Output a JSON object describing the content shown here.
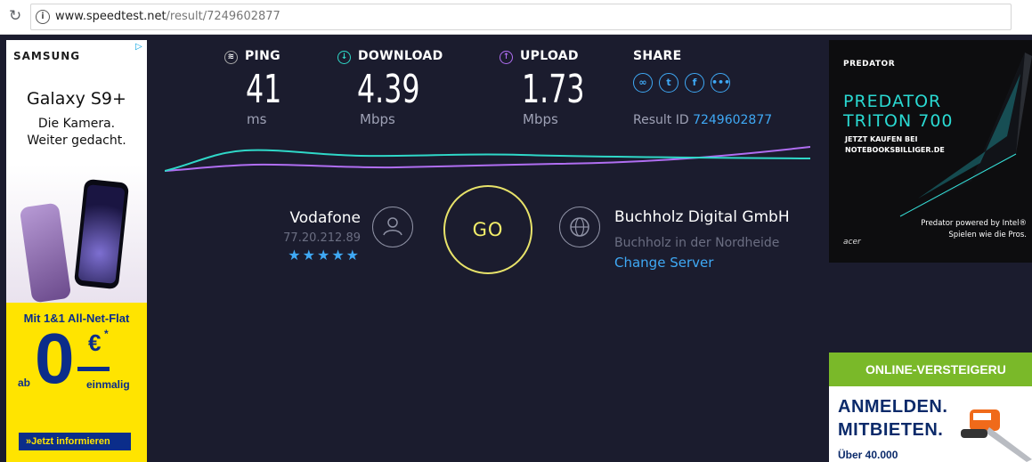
{
  "browser": {
    "url_domain": "www.speedtest.net",
    "url_path": "/result/7249602877"
  },
  "left_ad": {
    "brand": "SAMSUNG",
    "product": "Galaxy S9+",
    "tagline_1": "Die Kamera.",
    "tagline_2": "Weiter gedacht.",
    "offer": "Mit 1&1 All-Net-Flat",
    "price_prefix": "ab",
    "price_digit": "0",
    "price_currency": "€",
    "price_star": "*",
    "price_suffix": "einmalig",
    "cta": "»Jetzt informieren"
  },
  "results": {
    "ping": {
      "label": "PING",
      "value": "41",
      "unit": "ms"
    },
    "download": {
      "label": "DOWNLOAD",
      "value": "4.39",
      "unit": "Mbps"
    },
    "upload": {
      "label": "UPLOAD",
      "value": "1.73",
      "unit": "Mbps"
    },
    "share": {
      "label": "SHARE",
      "icons": [
        "link-icon",
        "twitter-icon",
        "facebook-icon",
        "more-icon"
      ]
    },
    "result_id_label": "Result ID",
    "result_id": "7249602877"
  },
  "isp": {
    "name": "Vodafone",
    "ip": "77.20.212.89",
    "stars": "★★★★★"
  },
  "go_label": "GO",
  "server": {
    "name": "Buchholz Digital GmbH",
    "location": "Buchholz in der Nordheide",
    "change_label": "Change Server"
  },
  "right_ad_1": {
    "brand": "PREDATOR",
    "title_1": "PREDATOR",
    "title_2": "TRITON 700",
    "cta_1": "JETZT KAUFEN BEI",
    "cta_2": "NOTEBOOKSBILLIGER.DE",
    "foot_1": "Predator powered by Intel®",
    "foot_2": "Spielen wie die Pros.",
    "maker": "acer"
  },
  "right_ad_2": {
    "header": "ONLINE-VERSTEIGERU",
    "line_1": "ANMELDEN.",
    "line_2": "MITBIETEN.",
    "small": "Über 40.000"
  },
  "colors": {
    "background": "#1b1c2e",
    "accent_blue": "#3fa9f5",
    "go_yellow": "#e8e36a",
    "download_line": "#2fd8c8",
    "upload_line": "#b06ef2"
  }
}
